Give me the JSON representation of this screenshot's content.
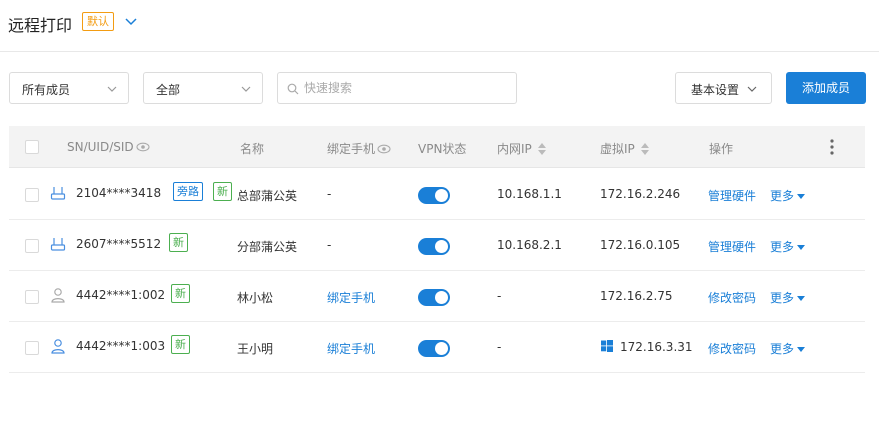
{
  "header": {
    "title": "远程打印",
    "badge": "默认"
  },
  "toolbar": {
    "member_filter": "所有成员",
    "status_filter": "全部",
    "search_placeholder": "快速搜索",
    "settings_label": "基本设置",
    "add_label": "添加成员"
  },
  "columns": {
    "sn": "SN/UID/SID",
    "name": "名称",
    "phone": "绑定手机",
    "vpn": "VPN状态",
    "lan_ip": "内网IP",
    "virtual_ip": "虚拟IP",
    "actions": "操作"
  },
  "rows": [
    {
      "device": "router-icon",
      "sn": "2104****3418",
      "tags": [
        "旁路",
        "新"
      ],
      "name": "总部蒲公英",
      "phone": "-",
      "phone_is_link": false,
      "vpn_on": true,
      "lan_ip": "10.168.1.1",
      "virtual_ip": "172.16.2.246",
      "windows": false,
      "action": "管理硬件",
      "more": "更多"
    },
    {
      "device": "router-icon",
      "sn": "2607****5512",
      "tags": [
        "新"
      ],
      "name": "分部蒲公英",
      "phone": "-",
      "phone_is_link": false,
      "vpn_on": true,
      "lan_ip": "10.168.2.1",
      "virtual_ip": "172.16.0.105",
      "windows": false,
      "action": "管理硬件",
      "more": "更多"
    },
    {
      "device": "user-icon",
      "sn": "4442****1:002",
      "tags": [
        "新"
      ],
      "name": "林小松",
      "phone": "绑定手机",
      "phone_is_link": true,
      "vpn_on": true,
      "lan_ip": "-",
      "virtual_ip": "172.16.2.75",
      "windows": false,
      "action": "修改密码",
      "more": "更多"
    },
    {
      "device": "user-icon",
      "sn": "4442****1:003",
      "tags": [
        "新"
      ],
      "name": "王小明",
      "phone": "绑定手机",
      "phone_is_link": true,
      "vpn_on": true,
      "lan_ip": "-",
      "virtual_ip": "172.16.3.31",
      "windows": true,
      "action": "修改密码",
      "more": "更多"
    }
  ],
  "colors": {
    "accent": "#1a7fd7",
    "default_badge": "#f39c12",
    "new_tag": "#4caf50"
  }
}
